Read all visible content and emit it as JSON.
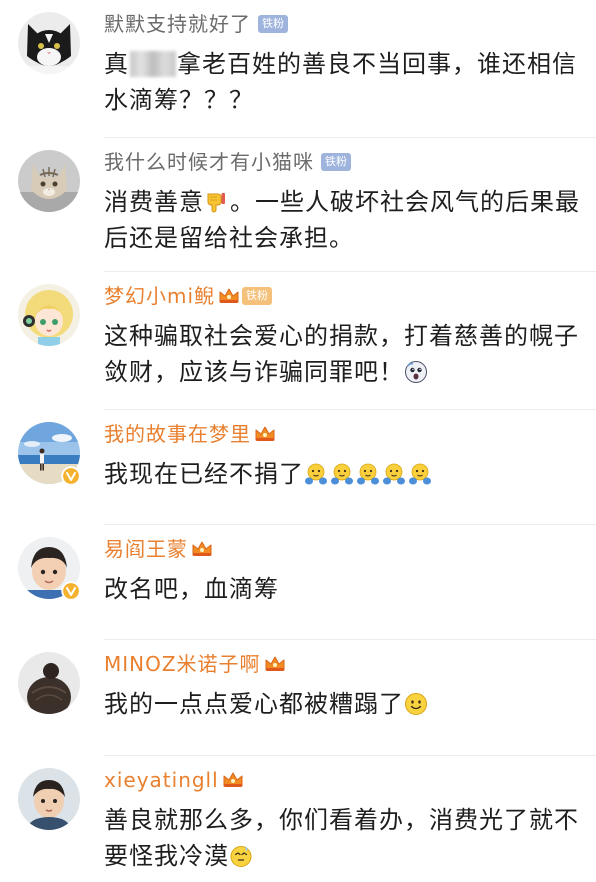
{
  "comments": [
    {
      "username": "默默支持就好了",
      "badge": "铁粉",
      "text_parts": [
        "真",
        "拿老百姓的善良不当回事，谁还相信水滴筹？？？"
      ]
    },
    {
      "username": "我什么时候才有小猫咪",
      "badge": "铁粉",
      "text_parts": [
        "消费善意",
        "。一些人破坏社会风气的后果最后还是留给社会承担。"
      ],
      "emojis": [
        "thumbs-down-icon"
      ]
    },
    {
      "username": "梦幻小mi鲵",
      "member_icon": "vip-crown-icon",
      "badge": "铁粉",
      "text_parts": [
        "这种骗取社会爱心的捐款，打着慈善的幌子敛财，应该与诈骗同罪吧！"
      ],
      "emojis": [
        "shocked-face-icon"
      ]
    },
    {
      "username": "我的故事在梦里",
      "member_icon": "vip-crown-icon",
      "verified_icon": "verified-badge-icon",
      "text_parts": [
        "我现在已经不捐了"
      ],
      "emojis": [
        "hug-icon",
        "hug-icon",
        "hug-icon",
        "hug-icon",
        "hug-icon"
      ]
    },
    {
      "username": "易阎王蒙",
      "member_icon": "vip-crown-icon",
      "verified_icon": "verified-badge-icon",
      "text_parts": [
        "改名吧，血滴筹"
      ]
    },
    {
      "username": "MINOZ米诺子啊",
      "member_icon": "vip-crown-icon",
      "text_parts": [
        "我的一点点爱心都被糟蹋了"
      ],
      "emojis": [
        "smile-face-icon"
      ]
    },
    {
      "username": "xieyatingll",
      "member_icon": "vip-crown-icon",
      "text_parts": [
        "善良就那么多，你们看着办，消费光了就不要怪我冷漠"
      ],
      "emojis": [
        "squint-face-icon"
      ]
    }
  ],
  "colors": {
    "vip_name": "#e9802f",
    "normal_name": "#6b6b6b",
    "body_text": "#1e1e1e",
    "fan_badge": "#9fb4dc",
    "fan_badge_vip": "#f4c07a",
    "vip_crown": "#f28c22",
    "verified_badge": "#f5b22e",
    "divider": "#ececec",
    "background": "#ffffff"
  }
}
